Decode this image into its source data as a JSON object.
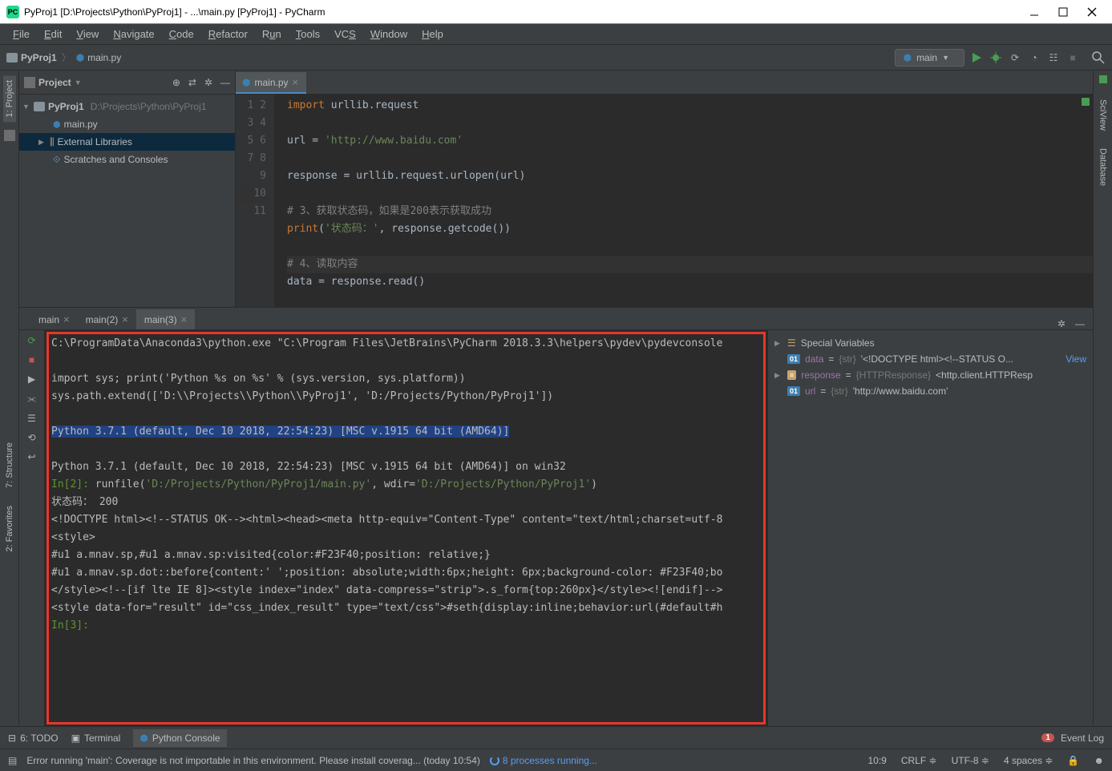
{
  "window": {
    "title": "PyProj1 [D:\\Projects\\Python\\PyProj1] - ...\\main.py [PyProj1] - PyCharm",
    "app_icon_text": "PC"
  },
  "menu": [
    "File",
    "Edit",
    "View",
    "Navigate",
    "Code",
    "Refactor",
    "Run",
    "Tools",
    "VCS",
    "Window",
    "Help"
  ],
  "breadcrumb": {
    "project": "PyProj1",
    "file": "main.py"
  },
  "run_config": {
    "label": "main"
  },
  "project_panel": {
    "header": "Project",
    "root": "PyProj1",
    "root_path": "D:\\Projects\\Python\\PyProj1",
    "file1": "main.py",
    "ext_lib": "External Libraries",
    "scratches": "Scratches and Consoles"
  },
  "editor": {
    "tab_label": "main.py",
    "lines": [
      "1",
      "2",
      "3",
      "4",
      "5",
      "6",
      "7",
      "8",
      "9",
      "10",
      "11"
    ],
    "code": {
      "l1_kw": "import",
      "l1_rest": " urllib.request",
      "l3_a": "url = ",
      "l3_str": "'http://www.baidu.com'",
      "l5": "response = urllib.request.urlopen(url)",
      "l7": "# 3、获取状态码，如果是200表示获取成功",
      "l8_a": "print",
      "l8_b": "(",
      "l8_str": "'状态码：'",
      "l8_c": ", response.getcode())",
      "l10": "# 4、读取内容",
      "l11": "data = response.read()"
    }
  },
  "run_tabs": [
    "main",
    "main(2)",
    "main(3)"
  ],
  "console": {
    "l1": "C:\\ProgramData\\Anaconda3\\python.exe \"C:\\Program Files\\JetBrains\\PyCharm 2018.3.3\\helpers\\pydev\\pydevconsole",
    "l2": "import sys; print('Python %s on %s' % (sys.version, sys.platform))",
    "l3": "sys.path.extend(['D:\\\\Projects\\\\Python\\\\PyProj1', 'D:/Projects/Python/PyProj1'])",
    "l4": "Python 3.7.1 (default, Dec 10 2018, 22:54:23) [MSC v.1915 64 bit (AMD64)]",
    "l5": "Python 3.7.1 (default, Dec 10 2018, 22:54:23) [MSC v.1915 64 bit (AMD64)] on win32",
    "l6_in": "In[2]:",
    "l6_a": " runfile(",
    "l6_s1": "'D:/Projects/Python/PyProj1/main.py'",
    "l6_b": ", wdir=",
    "l6_s2": "'D:/Projects/Python/PyProj1'",
    "l6_c": ")",
    "l7": "状态码： 200",
    "l8": "<!DOCTYPE html><!--STATUS OK--><html><head><meta http-equiv=\"Content-Type\" content=\"text/html;charset=utf-8",
    "l9": "<style>",
    "l10": "#u1 a.mnav.sp,#u1 a.mnav.sp:visited{color:#F23F40;position: relative;}",
    "l11": "#u1 a.mnav.sp.dot::before{content:' ';position: absolute;width:6px;height: 6px;background-color: #F23F40;bo",
    "l12": "</style><!--[if lte IE 8]><style index=\"index\" data-compress=\"strip\">.s_form{top:260px}</style><![endif]-->",
    "l13": "<style data-for=\"result\" id=\"css_index_result\" type=\"text/css\">#seth{display:inline;behavior:url(#default#h",
    "l14": "In[3]:"
  },
  "variables": {
    "header": "Special Variables",
    "rows": [
      {
        "badge": "01",
        "name": "data",
        "type": "{str}",
        "val": "'<!DOCTYPE html><!--STATUS O...",
        "link": "View"
      },
      {
        "badge": "≡",
        "name": "response",
        "type": "{HTTPResponse}",
        "val": "<http.client.HTTPResp"
      },
      {
        "badge": "01",
        "name": "url",
        "type": "{str}",
        "val": "'http://www.baidu.com'"
      }
    ]
  },
  "bottom_tabs": {
    "todo": "6: TODO",
    "terminal": "Terminal",
    "console": "Python Console",
    "eventlog": "Event Log",
    "notif_count": "1"
  },
  "status": {
    "error": "Error running 'main': Coverage is not importable in this environment. Please install coverag... (today 10:54)",
    "processes": "8 processes running...",
    "pos": "10:9",
    "crlf": "CRLF",
    "enc": "UTF-8",
    "indent": "4 spaces"
  },
  "left_tabs": {
    "project": "1: Project",
    "structure": "7: Structure",
    "favorites": "2: Favorites"
  },
  "right_tabs": {
    "sciview": "SciView",
    "database": "Database"
  }
}
